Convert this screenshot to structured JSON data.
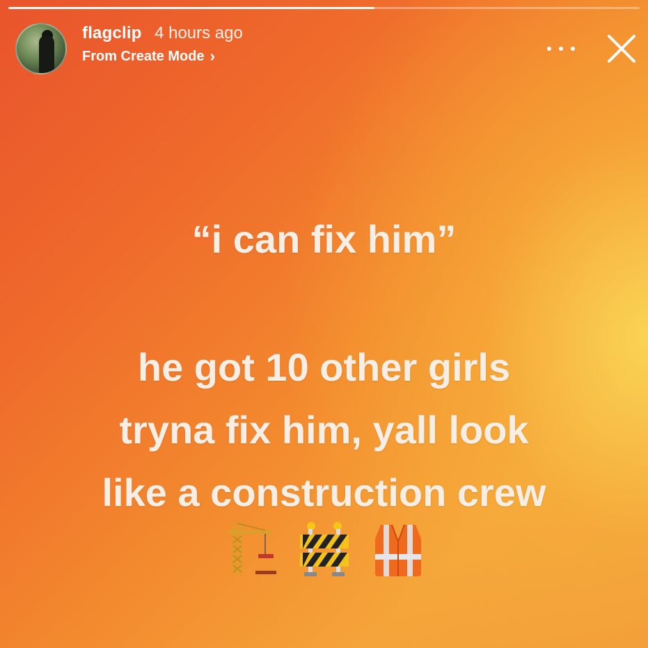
{
  "story": {
    "progress": 0.58
  },
  "header": {
    "username": "flagclip",
    "time_ago": "4 hours ago",
    "subtitle": "From Create Mode",
    "subtitle_chevron": "›"
  },
  "icons": {
    "more": "more-horizontal-icon",
    "close": "close-icon",
    "emojis": [
      "construction-crane-icon",
      "construction-barrier-icon",
      "safety-vest-icon"
    ]
  },
  "content": {
    "quote": "“i can fix him”",
    "line1": "he got 10 other girls",
    "line2": "tryna fix him, yall look",
    "line3": "like a construction crew"
  },
  "colors": {
    "gradient_start": "#e9542c",
    "gradient_end": "#fad656",
    "text": "#f7efe6"
  }
}
